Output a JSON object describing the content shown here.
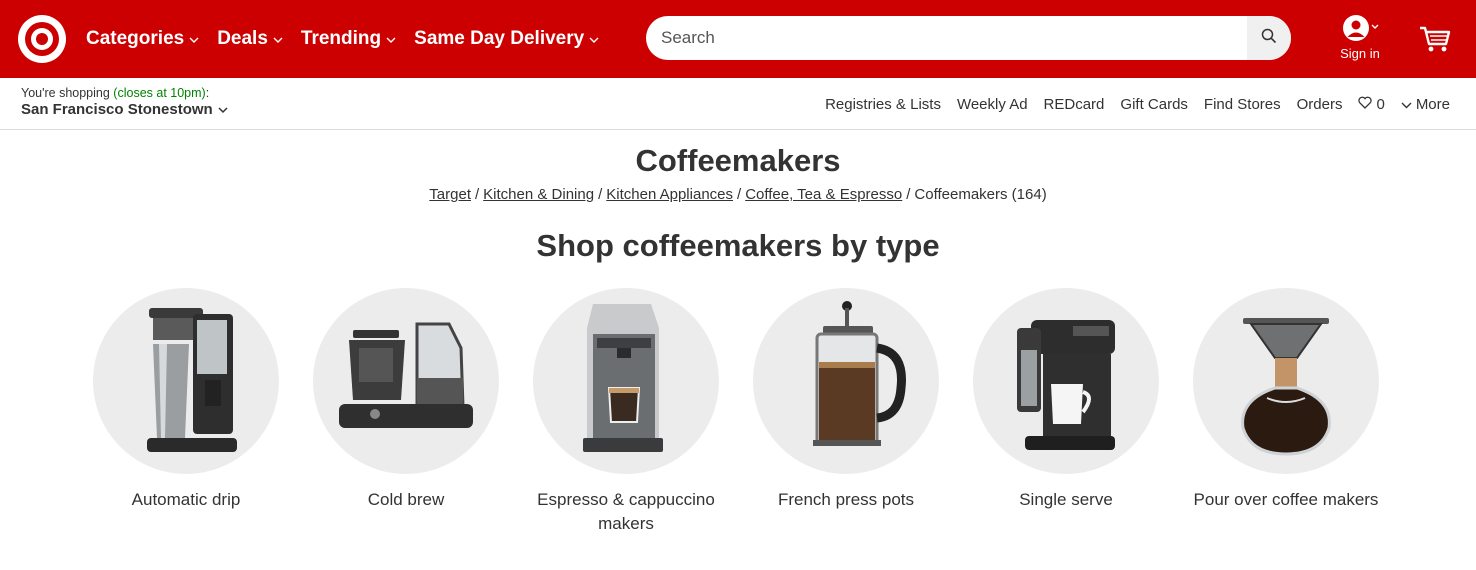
{
  "header": {
    "nav": [
      {
        "label": "Categories"
      },
      {
        "label": "Deals"
      },
      {
        "label": "Trending"
      },
      {
        "label": "Same Day Delivery"
      }
    ],
    "search_placeholder": "Search",
    "signin_label": "Sign in"
  },
  "subbar": {
    "store_prefix": "You're shopping",
    "store_hours": "(closes at 10pm)",
    "store_suffix": ":",
    "store_name": "San Francisco Stonestown",
    "links": [
      "Registries & Lists",
      "Weekly Ad",
      "REDcard",
      "Gift Cards",
      "Find Stores",
      "Orders"
    ],
    "favorites_count": "0",
    "more_label": "More"
  },
  "page": {
    "title": "Coffeemakers",
    "breadcrumbs": [
      "Target",
      "Kitchen & Dining",
      "Kitchen Appliances",
      "Coffee, Tea & Espresso"
    ],
    "current": "Coffeemakers (164)",
    "section_title": "Shop coffeemakers by type"
  },
  "categories": [
    {
      "label": "Automatic drip",
      "icon": "drip-coffeemaker-image"
    },
    {
      "label": "Cold brew",
      "icon": "cold-brew-maker-image"
    },
    {
      "label": "Espresso & cappuccino makers",
      "icon": "espresso-machine-image"
    },
    {
      "label": "French press pots",
      "icon": "french-press-image"
    },
    {
      "label": "Single serve",
      "icon": "single-serve-brewer-image"
    },
    {
      "label": "Pour over coffee makers",
      "icon": "pour-over-carafe-image"
    }
  ],
  "colors": {
    "brand": "#cc0000",
    "store_hours": "#008300"
  }
}
